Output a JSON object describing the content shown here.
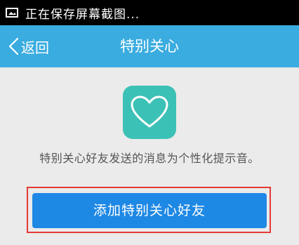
{
  "status_bar": {
    "icon": "image-icon",
    "text": "正在保存屏幕截图..."
  },
  "title_bar": {
    "back_label": "返回",
    "title": "特别关心",
    "background_color": "#3aace0"
  },
  "main": {
    "icon": "heart-icon",
    "icon_color": "#3cc1b6",
    "description": "特别关心好友发送的消息为个性化提示音。",
    "add_button_label": "添加特别关心好友",
    "button_color": "#1e88e5",
    "highlight_color": "#e53935"
  }
}
